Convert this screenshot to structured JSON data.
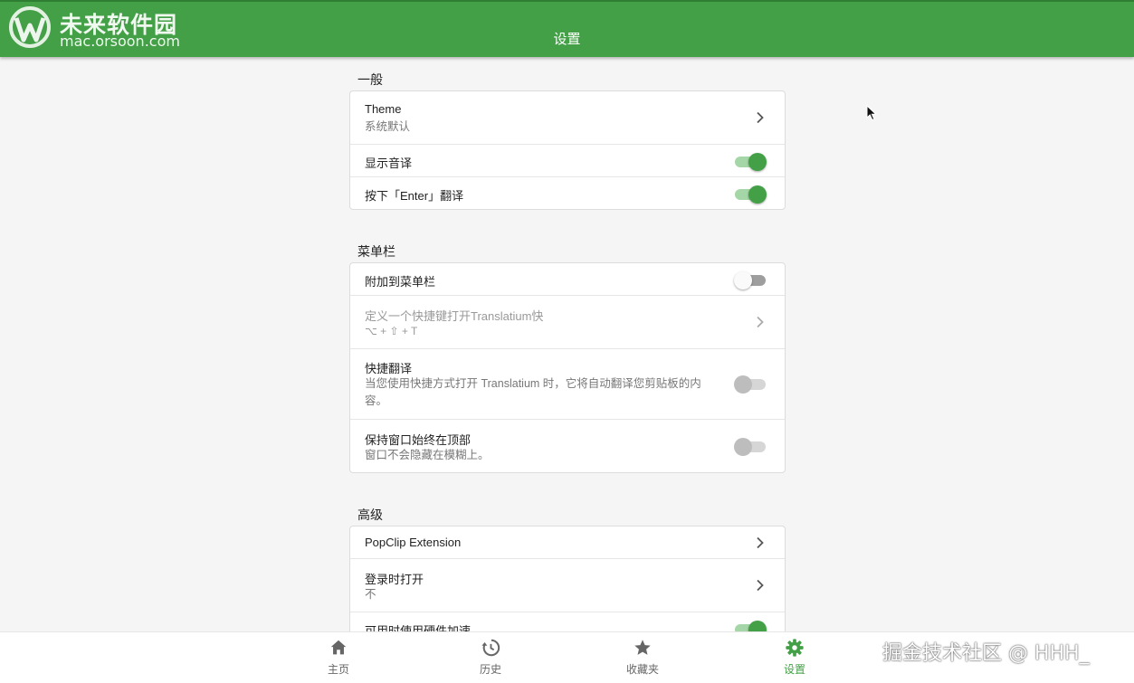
{
  "appbar": {
    "title": "设置",
    "watermark_cn": "未来软件园",
    "watermark_url": "mac.orsoon.com"
  },
  "sections": {
    "general": {
      "title": "一般",
      "theme": {
        "title": "Theme",
        "subtitle": "系统默认"
      },
      "show_phonetic": {
        "title": "显示音译",
        "enabled": true
      },
      "enter_translate": {
        "title": "按下「Enter」翻译",
        "enabled": true
      }
    },
    "menubar": {
      "title": "菜单栏",
      "attach": {
        "title": "附加到菜单栏",
        "enabled": false
      },
      "shortcut": {
        "title": "定义一个快捷键打开Translatium快",
        "subtitle": "⌥ + ⇧ + T"
      },
      "quick_translate": {
        "title": "快捷翻译",
        "subtitle_line1": "当您使用快捷方式打开 Translatium 时，它将自动翻译您剪贴板的内",
        "subtitle_line2": "容。",
        "enabled": false
      },
      "always_on_top": {
        "title": "保持窗口始终在顶部",
        "subtitle": "窗口不会隐藏在模糊上。",
        "enabled": false
      }
    },
    "advanced": {
      "title": "高级",
      "popclip": {
        "title": "PopClip Extension"
      },
      "open_at_login": {
        "title": "登录时打开",
        "subtitle": "不"
      },
      "hw_accel": {
        "title": "可用时使用硬件加速",
        "enabled": true
      }
    }
  },
  "bottom_nav": {
    "home": "主页",
    "history": "历史",
    "favorites": "收藏夹",
    "settings": "设置"
  },
  "watermark_juejin": "掘金技术社区 @ HHH_",
  "colors": {
    "primary": "#43a047",
    "track_on": "#a5d6a7"
  }
}
